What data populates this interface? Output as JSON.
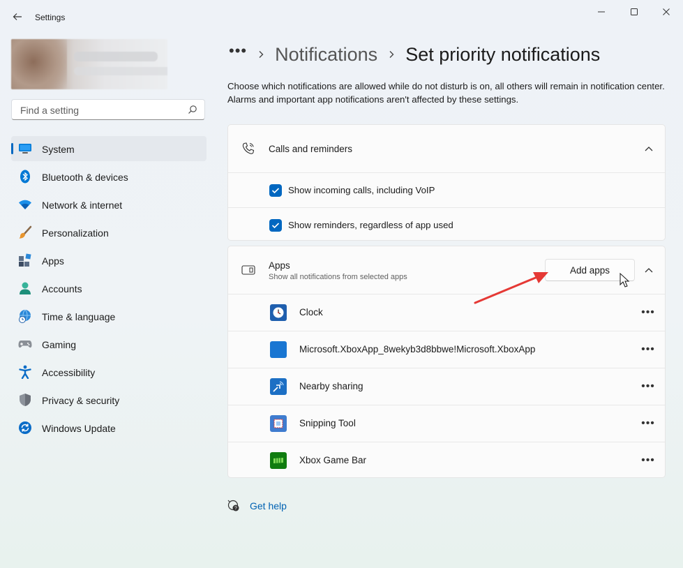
{
  "window": {
    "app_title": "Settings"
  },
  "search": {
    "placeholder": "Find a setting"
  },
  "sidebar": {
    "items": [
      {
        "label": "System",
        "icon": "system-icon",
        "active": true
      },
      {
        "label": "Bluetooth & devices",
        "icon": "bluetooth-icon"
      },
      {
        "label": "Network & internet",
        "icon": "wifi-icon"
      },
      {
        "label": "Personalization",
        "icon": "brush-icon"
      },
      {
        "label": "Apps",
        "icon": "apps-icon"
      },
      {
        "label": "Accounts",
        "icon": "account-icon"
      },
      {
        "label": "Time & language",
        "icon": "globe-clock-icon"
      },
      {
        "label": "Gaming",
        "icon": "gamepad-icon"
      },
      {
        "label": "Accessibility",
        "icon": "accessibility-icon"
      },
      {
        "label": "Privacy & security",
        "icon": "shield-icon"
      },
      {
        "label": "Windows Update",
        "icon": "update-icon"
      }
    ]
  },
  "header": {
    "more": "•••",
    "parent": "Notifications",
    "current": "Set priority notifications"
  },
  "description": "Choose which notifications are allowed while do not disturb is on, all others will remain in notification center. Alarms and important app notifications aren't affected by these settings.",
  "calls_section": {
    "title": "Calls and reminders",
    "options": [
      {
        "label": "Show incoming calls, including VoIP",
        "checked": true
      },
      {
        "label": "Show reminders, regardless of app used",
        "checked": true
      }
    ]
  },
  "apps_section": {
    "title": "Apps",
    "subtitle": "Show all notifications from selected apps",
    "add_button": "Add apps",
    "apps": [
      {
        "name": "Clock",
        "icon": "clock-icon"
      },
      {
        "name": "Microsoft.XboxApp_8wekyb3d8bbwe!Microsoft.XboxApp",
        "icon": "xbox-app-icon"
      },
      {
        "name": "Nearby sharing",
        "icon": "nearby-sharing-icon"
      },
      {
        "name": "Snipping Tool",
        "icon": "snipping-tool-icon"
      },
      {
        "name": "Xbox Game Bar",
        "icon": "xbox-game-bar-icon"
      }
    ]
  },
  "help": {
    "label": "Get help"
  },
  "colors": {
    "accent": "#0067c0",
    "annotation_arrow": "#e53935"
  }
}
